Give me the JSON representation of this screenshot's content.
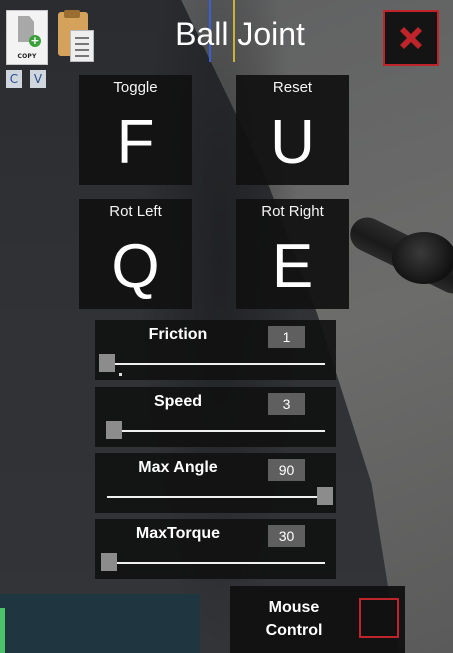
{
  "window": {
    "title": "Ball Joint"
  },
  "clipboard": {
    "copy_icon_text": "COPY",
    "copy_key": "C",
    "paste_key": "V"
  },
  "keybinds": [
    {
      "label": "Toggle",
      "key": "F"
    },
    {
      "label": "Reset",
      "key": "U"
    },
    {
      "label": "Rot Left",
      "key": "Q"
    },
    {
      "label": "Rot Right",
      "key": "E"
    }
  ],
  "sliders": [
    {
      "label": "Friction",
      "value": "1",
      "fraction": 0.0
    },
    {
      "label": "Speed",
      "value": "3",
      "fraction": 0.03
    },
    {
      "label": "Max Angle",
      "value": "90",
      "fraction": 1.0
    },
    {
      "label": "MaxTorque",
      "value": "30",
      "fraction": 0.01
    }
  ],
  "mouse_control": {
    "label_line1": "Mouse",
    "label_line2": "Control",
    "checked": false
  },
  "colors": {
    "accent_red": "#c0242b",
    "panel_bg": "#111111",
    "value_box": "#5f5f5f",
    "slider_thumb": "#8c8c8c"
  },
  "icons": {
    "close": "close-x-icon",
    "copy": "copy-document-icon",
    "paste": "paste-clipboard-icon"
  }
}
